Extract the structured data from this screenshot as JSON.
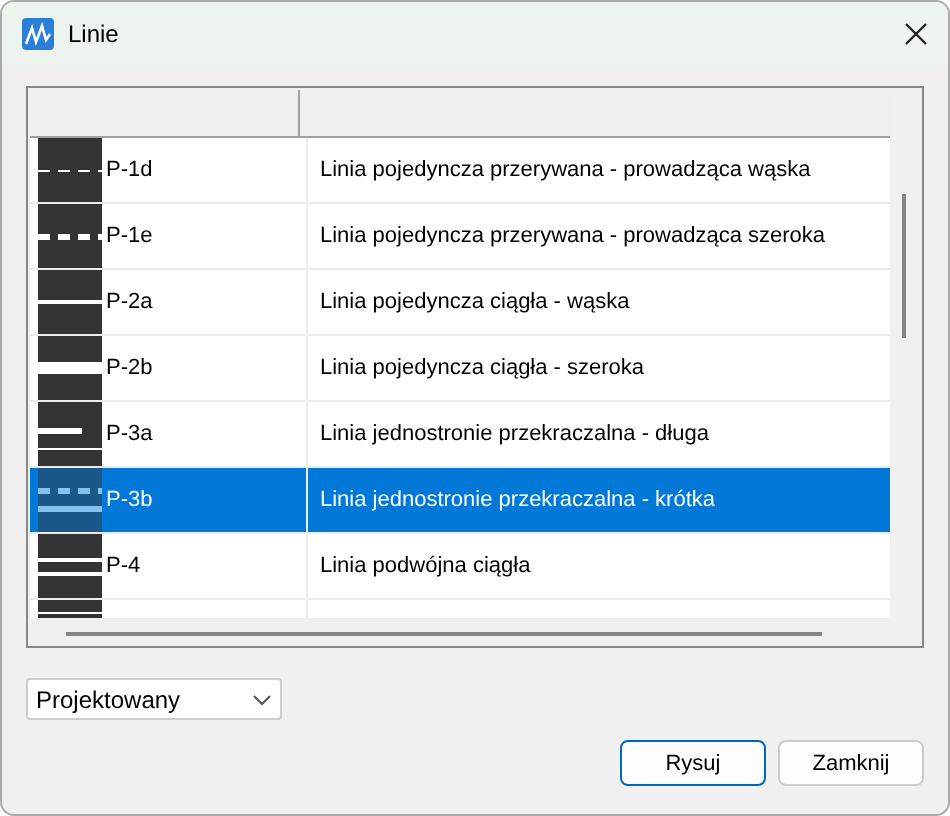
{
  "window": {
    "title": "Linie"
  },
  "table": {
    "rows": [
      {
        "kind": "dashed-thin",
        "code": "P-1d",
        "description": "Linia pojedyncza przerywana - prowadząca wąska",
        "selected": false
      },
      {
        "kind": "dashed-thick",
        "code": "P-1e",
        "description": "Linia pojedyncza przerywana - prowadząca szeroka",
        "selected": false
      },
      {
        "kind": "solid-thin",
        "code": "P-2a",
        "description": "Linia pojedyncza ciągła - wąska",
        "selected": false
      },
      {
        "kind": "solid-thick",
        "code": "P-2b",
        "description": "Linia pojedyncza ciągła - szeroka",
        "selected": false
      },
      {
        "kind": "short-bar",
        "code": "P-3a",
        "description": "Linia jednostronie przekraczalna - długa",
        "selected": false
      },
      {
        "kind": "dashed-solid",
        "code": "P-3b",
        "description": "Linia jednostronie przekraczalna - krótka",
        "selected": true
      },
      {
        "kind": "double",
        "code": "P-4",
        "description": "Linia podwójna ciągła",
        "selected": false
      },
      {
        "kind": "stripes",
        "selected": false
      }
    ]
  },
  "dropdown": {
    "value": "Projektowany"
  },
  "buttons": [
    {
      "label": "Rysuj",
      "default": true
    },
    {
      "label": "Zamknij",
      "default": false
    }
  ]
}
